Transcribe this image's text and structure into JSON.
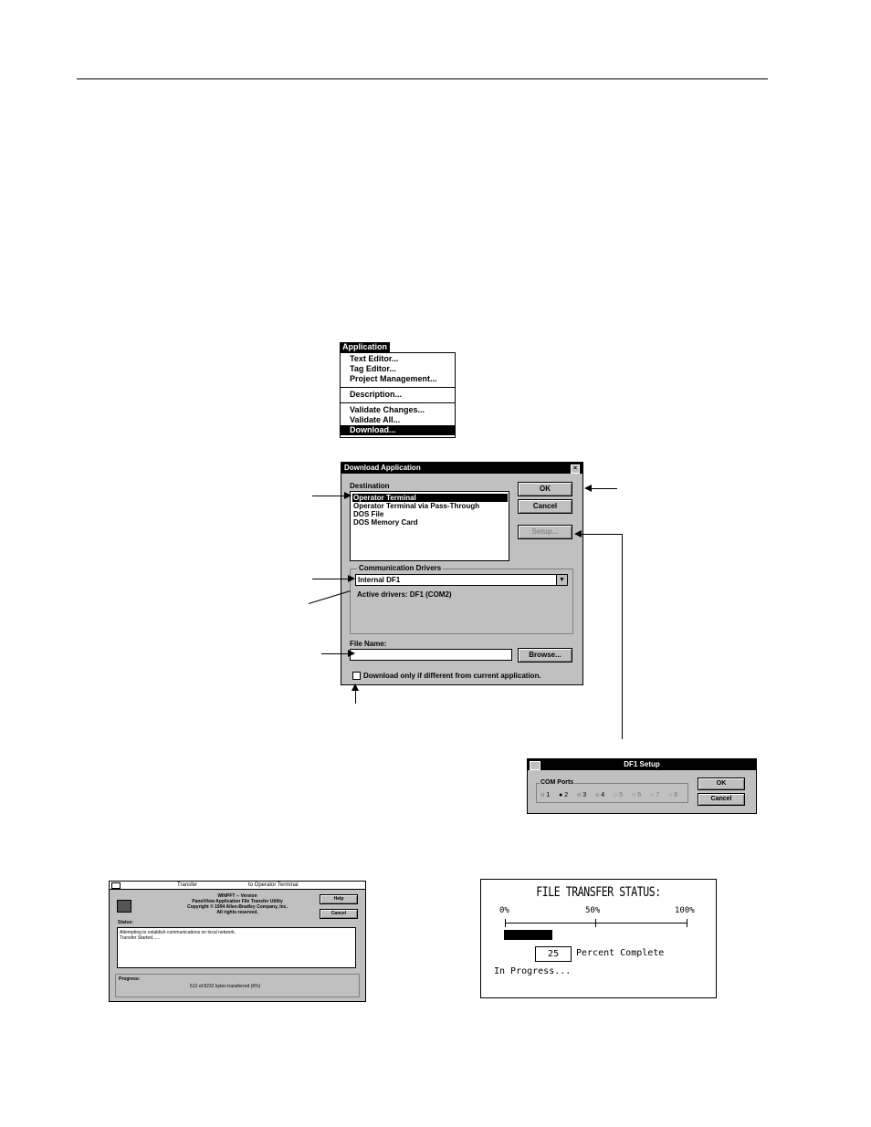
{
  "menu": {
    "title": "Application",
    "items": [
      {
        "label": "Text Editor..."
      },
      {
        "label": "Tag Editor..."
      },
      {
        "label": "Project Management..."
      },
      {
        "label": "Description..."
      },
      {
        "label": "Validate Changes..."
      },
      {
        "label": "Validate All..."
      },
      {
        "label": "Download..."
      }
    ]
  },
  "download_dialog": {
    "title": "Download Application",
    "close_glyph": "×",
    "destination_label": "Destination",
    "destinations": [
      "Operator Terminal",
      "Operator Terminal via Pass-Through",
      "DOS File",
      "DOS Memory Card"
    ],
    "selected_destination": "Operator Terminal",
    "ok_label": "OK",
    "cancel_label": "Cancel",
    "setup_label": "Setup...",
    "comm_drivers_label": "Communication Drivers",
    "comm_driver_value": "Internal DF1",
    "active_drivers": "Active drivers: DF1 (COM2)",
    "file_name_label": "File Name:",
    "file_name_value": "",
    "browse_label": "Browse...",
    "download_only_label": "Download only if different from current application.",
    "download_only_checked": false
  },
  "df1_setup": {
    "title": "DF1 Setup",
    "com_ports_label": "COM Ports",
    "ports": [
      "1",
      "2",
      "3",
      "4",
      "5",
      "6",
      "7",
      "8"
    ],
    "selected_port": "2",
    "ok_label": "OK",
    "cancel_label": "Cancel"
  },
  "transfer_dialog": {
    "title_left": "Transfer",
    "title_right": "to Operator Terminal",
    "app_name": "WINPFT -- Version",
    "app_desc": "PanelView Application File Transfer Utility",
    "copyright": "Copyright © 1994 Allen-Bradley Company, Inc.",
    "rights": "All rights reserved.",
    "help_label": "Help",
    "cancel_label": "Cancel",
    "status_label": "Status:",
    "status_line1": "Attempting to establish communications on local network.",
    "status_line2": "Transfer Started......",
    "progress_label": "Progress:",
    "progress_text": "512 of 8232 bytes transferred (6%)"
  },
  "file_transfer_status": {
    "title": "FILE TRANSFER STATUS:",
    "tick_0": "0%",
    "tick_50": "50%",
    "tick_100": "100%",
    "percent_complete": 25,
    "percent_value": "25",
    "percent_label": "Percent Complete",
    "state": "In Progress..."
  }
}
